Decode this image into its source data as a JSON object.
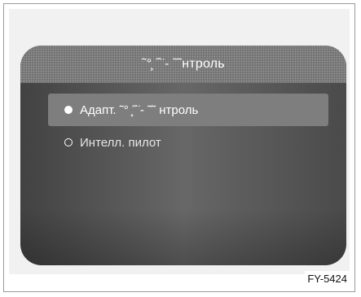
{
  "screen": {
    "title": "˜°̧ ˝¨- ˜˜нтроль",
    "items": [
      {
        "label": "Адапт. ˜° ̧˝¨- ˜˜ нтроль",
        "selected": true
      },
      {
        "label": "Интелл. пилот",
        "selected": false
      }
    ]
  },
  "figure_code": "FY-5424",
  "colors": {
    "screen_dark": "#424242",
    "screen_light": "#676767",
    "header": "#737373",
    "selected_row": "#7e7e7e",
    "text": "#ffffff"
  }
}
